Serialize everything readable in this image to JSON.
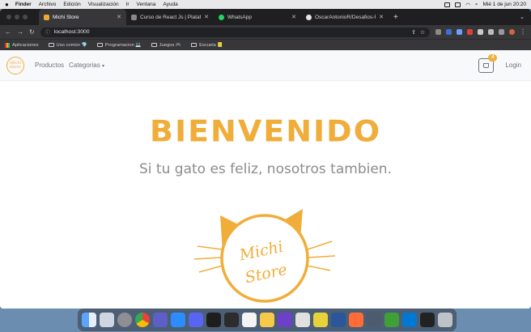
{
  "menubar": {
    "apple": "",
    "items": [
      "Finder",
      "Archivo",
      "Edición",
      "Visualización",
      "Ir",
      "Ventana",
      "Ayuda"
    ],
    "clock": "Mié 1 de jun  20:20"
  },
  "tabs": [
    {
      "label": "Michi Store",
      "icon": "michi-favicon"
    },
    {
      "label": "Curso de React Js | Plataforma",
      "icon": "platform-favicon"
    },
    {
      "label": "WhatsApp",
      "icon": "whatsapp-favicon"
    },
    {
      "label": "OscarAntonioR/Desafios-REACT",
      "icon": "github-favicon"
    }
  ],
  "address": {
    "url": "localhost:3000"
  },
  "bookmarks": [
    {
      "label": "Aplicaciones"
    },
    {
      "label": "Uso común 💎"
    },
    {
      "label": "Programacion 💻"
    },
    {
      "label": "Juegos 🎮"
    },
    {
      "label": "Escuela 📒"
    }
  ],
  "navbar": {
    "logo_line1": "Michi",
    "logo_line2": "Store",
    "products": "Productos",
    "categories": "Categorias",
    "cart_count": "4",
    "login": "Login"
  },
  "hero": {
    "title": "BIENVENIDO",
    "subtitle": "Si tu gato es feliz, nosotros tambien.",
    "logo_line1": "Michi",
    "logo_line2": "Store"
  },
  "colors": {
    "brand": "#f0ad3a",
    "muted": "#6c757d"
  },
  "dock": {
    "apps": [
      "finder-icon",
      "launchpad-icon",
      "settings-icon",
      "chrome-icon",
      "teams-icon",
      "zoom-icon",
      "discord-icon",
      "terminal-icon",
      "figma-icon",
      "notes-icon",
      "ai-icon",
      "github-icon",
      "slack-icon",
      "app-icon",
      "word-icon",
      "postman-icon",
      "sublime-icon",
      "mongodb-icon",
      "vscode-icon",
      "monitor-icon",
      "trash-icon"
    ]
  }
}
